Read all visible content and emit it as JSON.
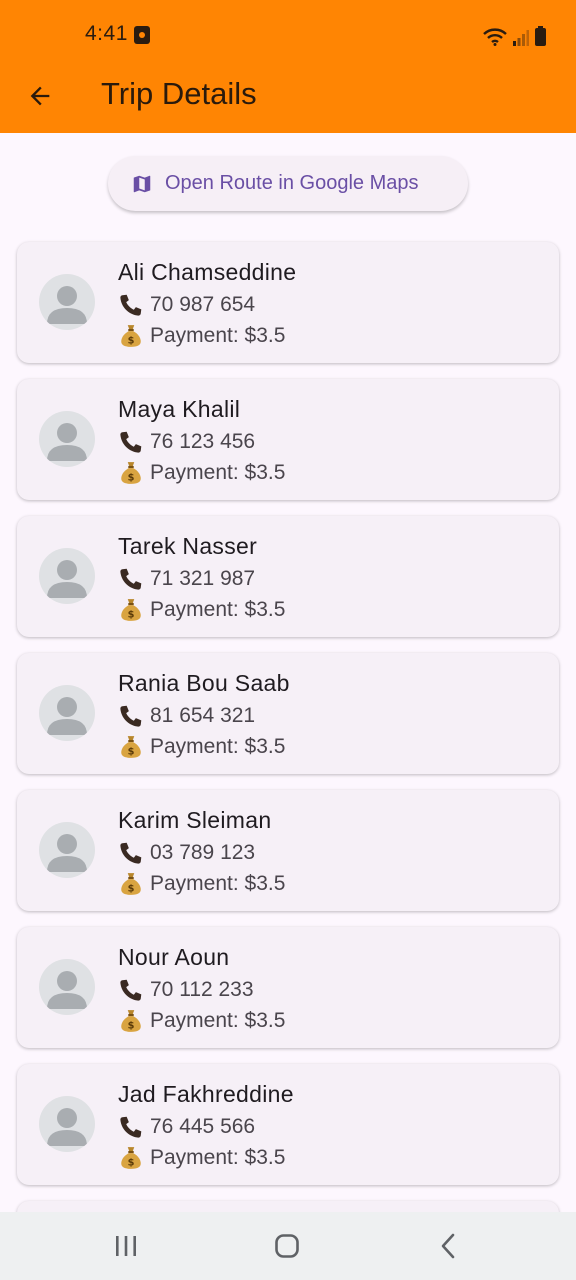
{
  "status_bar": {
    "time": "4:41"
  },
  "app_bar": {
    "title": "Trip Details"
  },
  "maps_button": {
    "label": "Open Route in Google Maps"
  },
  "passengers": [
    {
      "name": "Ali Chamseddine",
      "phone": "70 987 654",
      "payment": "Payment: $3.5"
    },
    {
      "name": "Maya Khalil",
      "phone": "76 123 456",
      "payment": "Payment: $3.5"
    },
    {
      "name": "Tarek Nasser",
      "phone": "71 321 987",
      "payment": "Payment: $3.5"
    },
    {
      "name": "Rania Bou Saab",
      "phone": "81 654 321",
      "payment": "Payment: $3.5"
    },
    {
      "name": "Karim Sleiman",
      "phone": "03 789 123",
      "payment": "Payment: $3.5"
    },
    {
      "name": "Nour Aoun",
      "phone": "70 112 233",
      "payment": "Payment: $3.5"
    },
    {
      "name": "Jad Fakhreddine",
      "phone": "76 445 566",
      "payment": "Payment: $3.5"
    }
  ],
  "colors": {
    "app_bar": "#ff8503",
    "background": "#fdf7fe",
    "card": "#f6f0f7",
    "accent": "#6a4fa5"
  },
  "icons": {
    "back": "arrow-left-icon",
    "maps": "map-icon",
    "phone": "telephone-receiver-icon",
    "payment": "money-bag-icon",
    "avatar": "person-placeholder-icon"
  }
}
